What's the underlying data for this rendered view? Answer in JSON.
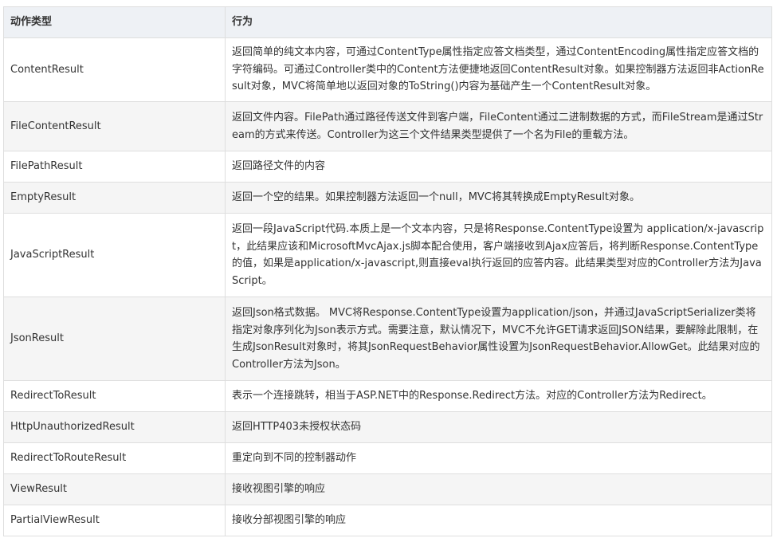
{
  "table": {
    "headers": {
      "type": "动作类型",
      "behavior": "行为"
    },
    "rows": [
      {
        "type": "ContentResult",
        "desc": "返回简单的纯文本内容，可通过ContentType属性指定应答文档类型，通过ContentEncoding属性指定应答文档的字符编码。可通过Controller类中的Content方法便捷地返回ContentResult对象。如果控制器方法返回非ActionResult对象，MVC将简单地以返回对象的ToString()内容为基础产生一个ContentResult对象。"
      },
      {
        "type": "FileContentResult",
        "desc": "返回文件内容。FilePath通过路径传送文件到客户端，FileContent通过二进制数据的方式，而FileStream是通过Stream的方式来传送。Controller为这三个文件结果类型提供了一个名为File的重载方法。"
      },
      {
        "type": "FilePathResult",
        "desc": "返回路径文件的内容"
      },
      {
        "type": "EmptyResult",
        "desc": "返回一个空的结果。如果控制器方法返回一个null，MVC将其转换成EmptyResult对象。"
      },
      {
        "type": "JavaScriptResult",
        "desc": "返回一段JavaScript代码.本质上是一个文本内容，只是将Response.ContentType设置为 application/x-javascript，此结果应该和MicrosoftMvcAjax.js脚本配合使用，客户端接收到Ajax应答后，将判断Response.ContentType的值，如果是application/x-javascript,则直接eval执行返回的应答内容。此结果类型对应的Controller方法为JavaScript。"
      },
      {
        "type": "JsonResult",
        "desc": "返回Json格式数据。 MVC将Response.ContentType设置为application/json，并通过JavaScriptSerializer类将指定对象序列化为Json表示方式。需要注意，默认情况下，MVC不允许GET请求返回JSON结果，要解除此限制，在生成JsonResult对象时，将其JsonRequestBehavior属性设置为JsonRequestBehavior.AllowGet。此结果对应的Controller方法为Json。"
      },
      {
        "type": "RedirectToResult",
        "desc": "表示一个连接跳转，相当于ASP.NET中的Response.Redirect方法。对应的Controller方法为Redirect。"
      },
      {
        "type": "HttpUnauthorizedResult",
        "desc": "返回HTTP403未授权状态码"
      },
      {
        "type": "RedirectToRouteResult",
        "desc": "重定向到不同的控制器动作"
      },
      {
        "type": "ViewResult",
        "desc": "接收视图引擎的响应"
      },
      {
        "type": "PartialViewResult",
        "desc": "接收分部视图引擎的响应"
      }
    ]
  }
}
